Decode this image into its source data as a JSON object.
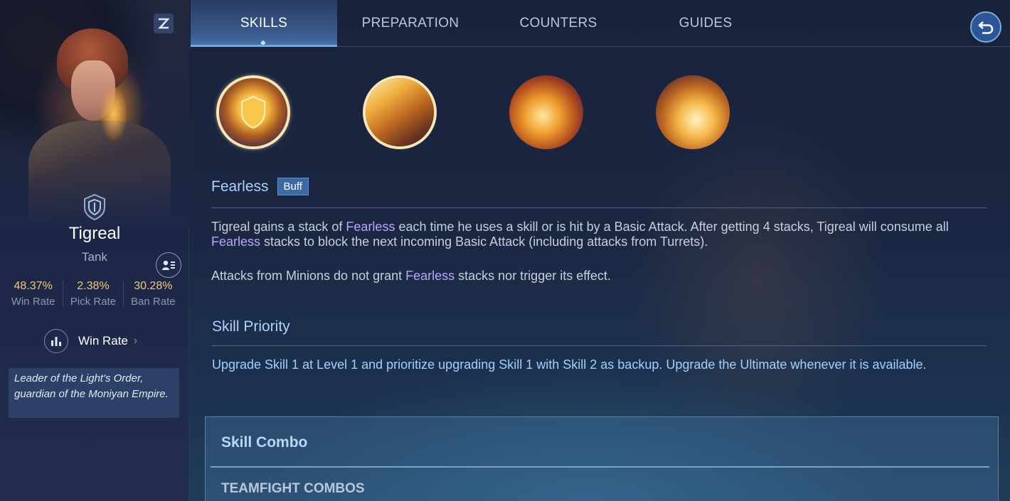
{
  "hero": {
    "name": "Tigreal",
    "role": "Tank",
    "role_icon": "shield-icon",
    "stats": [
      {
        "value": "48.37%",
        "label": "Win Rate"
      },
      {
        "value": "2.38%",
        "label": "Pick Rate"
      },
      {
        "value": "30.28%",
        "label": "Ban Rate"
      }
    ],
    "winrate_link": "Win Rate",
    "lore": "Leader of the Light's Order, guardian of the Moniyan Empire."
  },
  "tabs": [
    {
      "label": "SKILLS",
      "active": true
    },
    {
      "label": "PREPARATION",
      "active": false
    },
    {
      "label": "COUNTERS",
      "active": false
    },
    {
      "label": "GUIDES",
      "active": false
    }
  ],
  "skill_detail": {
    "name": "Fearless",
    "tag": "Buff",
    "p1_a": "Tigreal gains a stack of ",
    "p1_hl1": "Fearless",
    "p1_b": " each time he uses a skill or is hit by a Basic Attack. After getting 4 stacks, Tigreal will consume all ",
    "p1_hl2": "Fearless",
    "p1_c": " stacks to block the next incoming Basic Attack (including attacks from Turrets).",
    "p2_a": "Attacks from Minions do not grant ",
    "p2_hl": "Fearless",
    "p2_b": " stacks nor trigger its effect."
  },
  "priority": {
    "title": "Skill Priority",
    "text": "Upgrade Skill 1 at Level 1 and prioritize upgrading Skill 1 with Skill 2 as backup. Upgrade the Ultimate whenever it is available."
  },
  "combo": {
    "title": "Skill Combo",
    "subtitle": "TEAMFIGHT COMBOS"
  },
  "colors": {
    "accent": "#a9d4ff",
    "highlight": "#b9a6ff",
    "stat_value": "#f2c97a"
  }
}
